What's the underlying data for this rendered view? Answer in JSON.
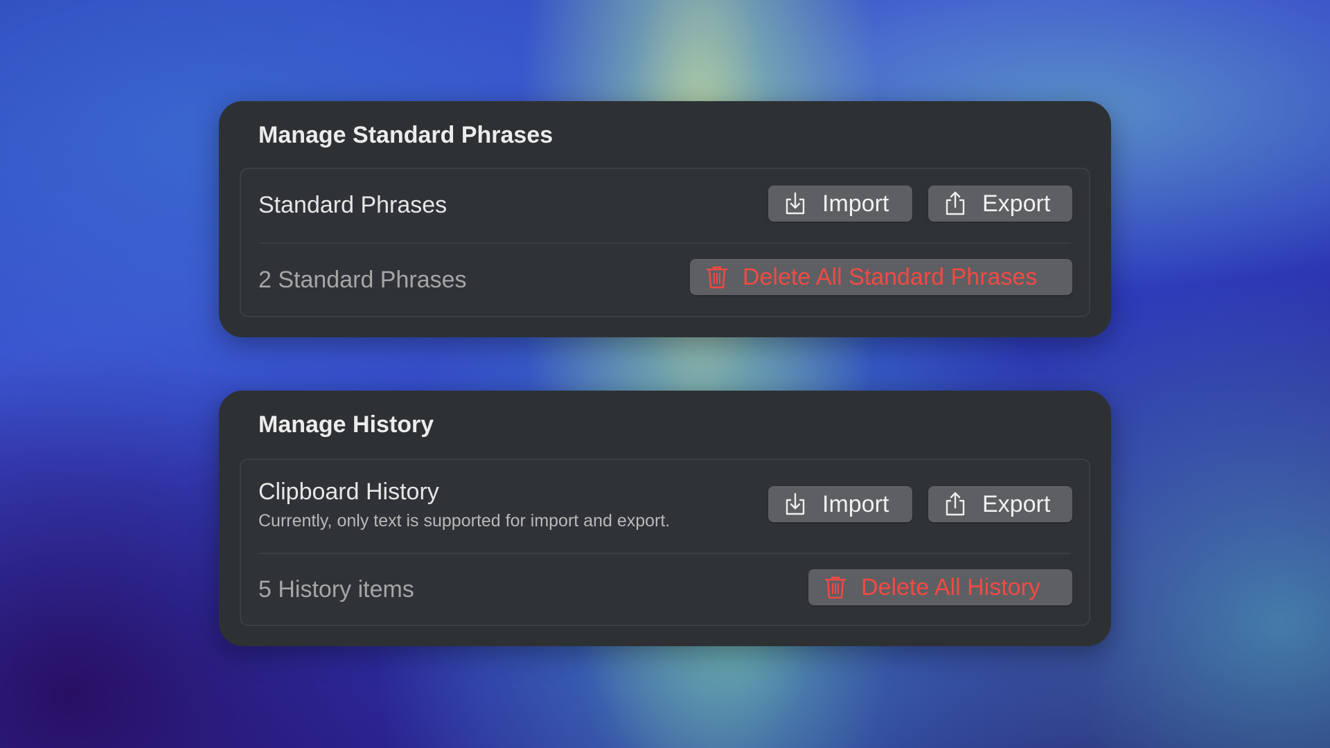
{
  "standard_phrases_section": {
    "title": "Manage Standard Phrases",
    "row_label": "Standard Phrases",
    "import_label": "Import",
    "export_label": "Export",
    "count_text": "2 Standard Phrases",
    "delete_label": "Delete All Standard Phrases",
    "import_icon": "import-tray-icon",
    "export_icon": "share-export-icon",
    "delete_icon": "trash-icon"
  },
  "history_section": {
    "title": "Manage History",
    "row_label": "Clipboard History",
    "row_subtitle": "Currently, only text is supported for import and export.",
    "import_label": "Import",
    "export_label": "Export",
    "count_text": "5 History items",
    "delete_label": "Delete All History",
    "import_icon": "import-tray-icon",
    "export_icon": "share-export-icon",
    "delete_icon": "trash-icon"
  },
  "colors": {
    "panel_background": "#2e3134",
    "button_background": "#5d5f62",
    "danger_text": "#f24a45"
  }
}
